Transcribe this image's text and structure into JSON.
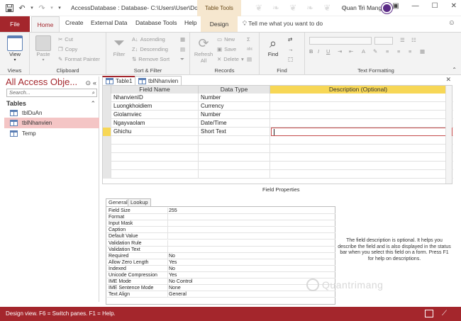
{
  "window": {
    "title": "AccessDatabase : Database- C:\\Users\\User\\Docu...",
    "context_tab": "Table Tools",
    "user": "Quan Tri Mang"
  },
  "tabs": {
    "file": "File",
    "home": "Home",
    "create": "Create",
    "external": "External Data",
    "dbtools": "Database Tools",
    "help": "Help",
    "design": "Design",
    "tell_me": "Tell me what you want to do"
  },
  "ribbon": {
    "views": {
      "label": "Views",
      "view": "View"
    },
    "clipboard": {
      "label": "Clipboard",
      "paste": "Paste",
      "cut": "Cut",
      "copy": "Copy",
      "format_painter": "Format Painter"
    },
    "sortfilter": {
      "label": "Sort & Filter",
      "filter": "Filter",
      "ascending": "Ascending",
      "descending": "Descending",
      "remove_sort": "Remove Sort"
    },
    "records": {
      "label": "Records",
      "refresh": "Refresh All",
      "new": "New",
      "save": "Save",
      "delete": "Delete"
    },
    "find": {
      "label": "Find",
      "find": "Find"
    },
    "text": {
      "label": "Text Formatting"
    }
  },
  "nav": {
    "header": "All Access Obje...",
    "search_placeholder": "Search...",
    "section": "Tables",
    "items": [
      {
        "label": "tblDuAn"
      },
      {
        "label": "tblNhanvien"
      },
      {
        "label": "Temp"
      }
    ]
  },
  "doc_tabs": [
    {
      "label": "Table1"
    },
    {
      "label": "tblNhanvien"
    }
  ],
  "design_grid": {
    "headers": [
      "Field Name",
      "Data Type",
      "Description (Optional)"
    ],
    "rows": [
      {
        "field": "NhanvienID",
        "type": "Number"
      },
      {
        "field": "Luongkhoidiem",
        "type": "Currency"
      },
      {
        "field": "Giolamviec",
        "type": "Number"
      },
      {
        "field": "Ngayvaolam",
        "type": "Date/Time"
      },
      {
        "field": "Ghichu",
        "type": "Short Text"
      }
    ]
  },
  "field_properties": {
    "title": "Field Properties",
    "tabs": [
      "General",
      "Lookup"
    ],
    "rows": [
      {
        "k": "Field Size",
        "v": "255"
      },
      {
        "k": "Format",
        "v": ""
      },
      {
        "k": "Input Mask",
        "v": ""
      },
      {
        "k": "Caption",
        "v": ""
      },
      {
        "k": "Default Value",
        "v": ""
      },
      {
        "k": "Validation Rule",
        "v": ""
      },
      {
        "k": "Validation Text",
        "v": ""
      },
      {
        "k": "Required",
        "v": "No"
      },
      {
        "k": "Allow Zero Length",
        "v": "Yes"
      },
      {
        "k": "Indexed",
        "v": "No"
      },
      {
        "k": "Unicode Compression",
        "v": "Yes"
      },
      {
        "k": "IME Mode",
        "v": "No Control"
      },
      {
        "k": "IME Sentence Mode",
        "v": "None"
      },
      {
        "k": "Text Align",
        "v": "General"
      }
    ],
    "help": "The field description is optional. It helps you describe the field and is also displayed in the status bar when you select this field on a form. Press F1 for help on descriptions."
  },
  "watermark": "Quantrimang",
  "status": "Design view.  F6 = Switch panes.  F1 = Help.",
  "colors": {
    "accent": "#a4262c",
    "context": "#f6e7cf",
    "selected": "#f7d756"
  }
}
